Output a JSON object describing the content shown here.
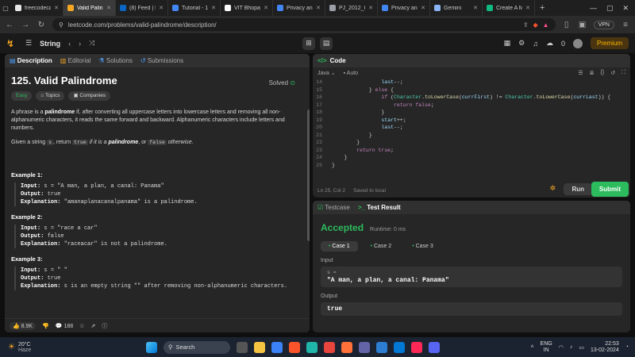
{
  "browser": {
    "tabs": [
      {
        "title": "freecodecamp",
        "color": "#e8e8e8",
        "active": false
      },
      {
        "title": "Valid Palin",
        "color": "#f5a623",
        "active": true
      },
      {
        "title": "(8) Feed | Linke",
        "color": "#0a66c2",
        "active": false
      },
      {
        "title": "Tutorial - 1",
        "color": "#4285f4",
        "active": false
      },
      {
        "title": "VIT Bhopal - V",
        "color": "#ffffff",
        "active": false
      },
      {
        "title": "Privacy and Se",
        "color": "#4285f4",
        "active": false
      },
      {
        "title": "PJ_2012_Comp",
        "color": "#9aa0a6",
        "active": false
      },
      {
        "title": "Privacy and Se",
        "color": "#4285f4",
        "active": false
      },
      {
        "title": "Gemini",
        "color": "#8ab4f8",
        "active": false
      },
      {
        "title": "Create A Mong",
        "color": "#10b981",
        "active": false
      }
    ],
    "url": "leetcode.com/problems/valid-palindrome/description/",
    "vpn": "VPN"
  },
  "nav": {
    "list": "String",
    "streak": "0",
    "premium": "Premium"
  },
  "left": {
    "tabs": [
      "Description",
      "Editorial",
      "Solutions",
      "Submissions"
    ],
    "title": "125. Valid Palindrome",
    "status": "Solved",
    "chips": [
      "Easy",
      "Topics",
      "Companies"
    ],
    "p1a": "A phrase is a ",
    "p1b": "palindrome",
    "p1c": " if, after converting all uppercase letters into lowercase letters and removing all non-alphanumeric characters, it reads the same forward and backward. Alphanumeric characters include letters and numbers.",
    "p2a": "Given a string ",
    "p2b": "s",
    "p2c": ", return ",
    "p2d": "true",
    "p2e": " if it is a ",
    "p2f": "palindrome",
    "p2g": ", or ",
    "p2h": "false",
    "p2i": " otherwise.",
    "examples": [
      {
        "title": "Example 1:",
        "input": "s = \"A man, a plan, a canal: Panama\"",
        "output": "true",
        "explanation": "\"amanaplanacanalpanama\" is a palindrome."
      },
      {
        "title": "Example 2:",
        "input": "s = \"race a car\"",
        "output": "false",
        "explanation": "\"raceacar\" is not a palindrome."
      },
      {
        "title": "Example 3:",
        "input": "s = \" \"",
        "output": "true",
        "explanation": "s is an empty string \"\" after removing non-alphanumeric characters."
      }
    ],
    "labels": {
      "input": "Input:",
      "output": "Output:",
      "explanation": "Explanation:"
    },
    "likes": "8.9K",
    "comments": "188"
  },
  "code": {
    "header": "Code",
    "language": "Java",
    "mode": "Auto",
    "lines": [
      {
        "n": "14",
        "html": "                last--;"
      },
      {
        "n": "15",
        "html": "            } else {"
      },
      {
        "n": "16",
        "html": "                if (Character.toLowerCase(currFirst) != Character.toLowerCase(currLast)) {"
      },
      {
        "n": "17",
        "html": "                    return false;"
      },
      {
        "n": "18",
        "html": "                }"
      },
      {
        "n": "19",
        "html": "                start++;"
      },
      {
        "n": "20",
        "html": "                last--;"
      },
      {
        "n": "21",
        "html": "            }"
      },
      {
        "n": "22",
        "html": "        }"
      },
      {
        "n": "23",
        "html": "        return true;"
      },
      {
        "n": "24",
        "html": "    }"
      },
      {
        "n": "25",
        "html": "}"
      }
    ],
    "cursor": "Ln 25, Col 2",
    "saved": "Saved to local",
    "run": "Run",
    "submit": "Submit"
  },
  "result": {
    "tabs": [
      "Testcase",
      "Test Result"
    ],
    "verdict": "Accepted",
    "runtime": "Runtime: 0 ms",
    "cases": [
      "Case 1",
      "Case 2",
      "Case 3"
    ],
    "input_label": "Input",
    "input_var": "s =",
    "input_value": "\"A man, a plan, a canal: Panama\"",
    "output_label": "Output",
    "output_value": "true"
  },
  "taskbar": {
    "temp": "20°C",
    "weather": "Haze",
    "search": "Search",
    "lang1": "ENG",
    "lang2": "IN",
    "time": "22:53",
    "date": "13-02-2024"
  }
}
